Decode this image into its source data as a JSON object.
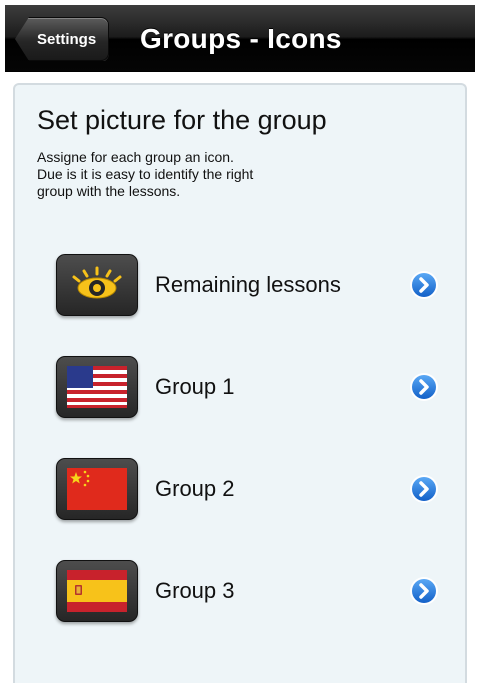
{
  "navbar": {
    "back_label": "Settings",
    "title": "Groups - Icons"
  },
  "content": {
    "heading": "Set picture for the group",
    "description_lines": [
      "Assigne for each group an icon.",
      "Due is it is easy to identify the right",
      "group with the lessons."
    ]
  },
  "groups": [
    {
      "label": "Remaining lessons",
      "icon": "eye-icon"
    },
    {
      "label": "Group 1",
      "icon": "us-flag-icon"
    },
    {
      "label": "Group 2",
      "icon": "china-flag-icon"
    },
    {
      "label": "Group 3",
      "icon": "spain-flag-icon"
    }
  ],
  "colors": {
    "navbar": "#0b0b0b",
    "card_background": "#eef5f8",
    "disclosure_blue": "#1e73d8"
  }
}
